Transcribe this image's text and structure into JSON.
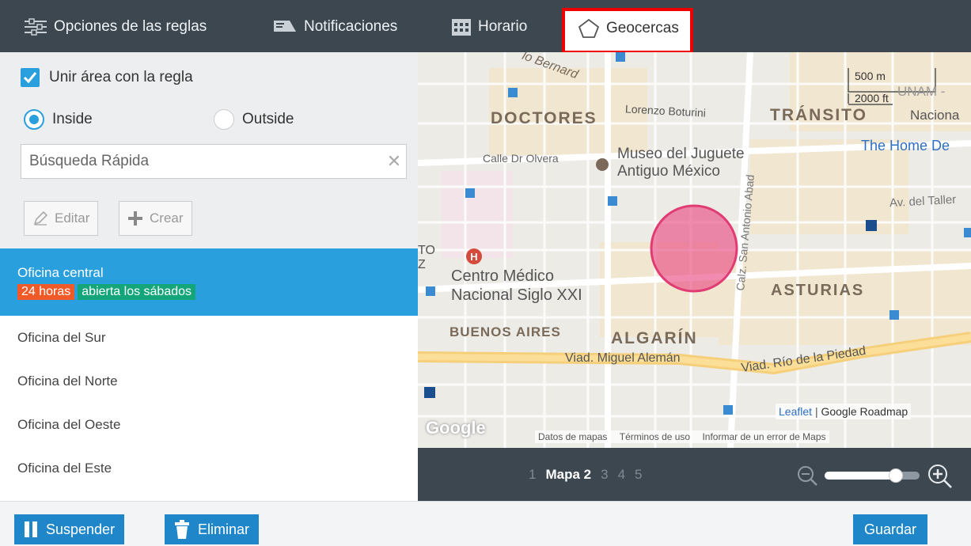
{
  "tabs": [
    {
      "label": "Opciones de las reglas",
      "icon": "sliders-icon"
    },
    {
      "label": "Notificaciones",
      "icon": "megaphone-icon"
    },
    {
      "label": "Horario",
      "icon": "calendar-icon"
    },
    {
      "label": "Geocercas",
      "icon": "pentagon-icon",
      "active": true
    }
  ],
  "filters": {
    "join_area_label": "Unir área con la regla",
    "inside_label": "Inside",
    "outside_label": "Outside",
    "search_placeholder": "Búsqueda Rápida"
  },
  "actions": {
    "edit_label": "Editar",
    "create_label": "Crear"
  },
  "geofences": {
    "selected": {
      "name": "Oficina central",
      "badge_hours": "24 horas",
      "badge_saturday": "abierta los sábados"
    },
    "items": [
      "Oficina del Sur",
      "Oficina del Norte",
      "Oficina del Oeste",
      "Oficina del Este"
    ]
  },
  "map": {
    "labels": {
      "bernard": "lo Bernard",
      "doctores": "DOCTORES",
      "boturini": "Lorenzo Boturini",
      "transito": "TRÁNSITO",
      "unam": "UNAM -",
      "nacional": "Naciona",
      "homedepot": "The Home De",
      "olvera": "Calle Dr Olvera",
      "museo1": "Museo del Juguete",
      "museo2": "Antiguo México",
      "taller": "Av. del Taller",
      "abad": "Calz. San Antonio Abad",
      "centro1": "Centro Médico",
      "centro2": "Nacional Siglo XXI",
      "asturias": "ASTURIAS",
      "buenosaires": "BUENOS AIRES",
      "algarin": "ALGARÍN",
      "aleman": "Viad. Miguel Alemán",
      "piedad": "Viad. Río de la Piedad",
      "to": "TO",
      "z": "Z"
    },
    "scale_metric": "500 m",
    "scale_imperial": "2000 ft",
    "attribution_leaflet": "Leaflet",
    "attribution_google": "Google Roadmap",
    "google_logo": "Google",
    "footer_data": "Datos de mapas",
    "footer_terms": "Términos de uso",
    "footer_report": "Informar de un error de Maps"
  },
  "pager": {
    "pages": [
      "1",
      "Mapa 2",
      "3",
      "4",
      "5"
    ],
    "current_index": 1
  },
  "zoom": {
    "level_fraction": 0.75
  },
  "bottom": {
    "suspend_label": "Suspender",
    "delete_label": "Eliminar",
    "save_label": "Guardar"
  },
  "colors": {
    "accent": "#2a9fdd",
    "button": "#1f86c9",
    "dark_bar": "#3d4750",
    "badge_orange": "#f05a28",
    "badge_green": "#15a57b",
    "geofence_circle": "#e94e86",
    "active_tab_border": "#ee0000"
  }
}
